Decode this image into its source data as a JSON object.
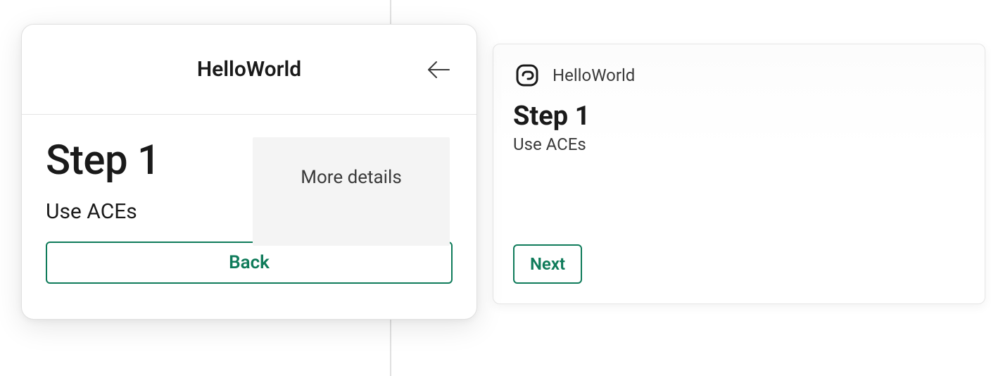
{
  "left_card": {
    "title": "HelloWorld",
    "step_title": "Step 1",
    "step_subtitle": "Use ACEs",
    "more_details_label": "More details",
    "back_button_label": "Back"
  },
  "right_card": {
    "title": "HelloWorld",
    "step_title": "Step 1",
    "step_subtitle": "Use ACEs",
    "next_button_label": "Next"
  }
}
